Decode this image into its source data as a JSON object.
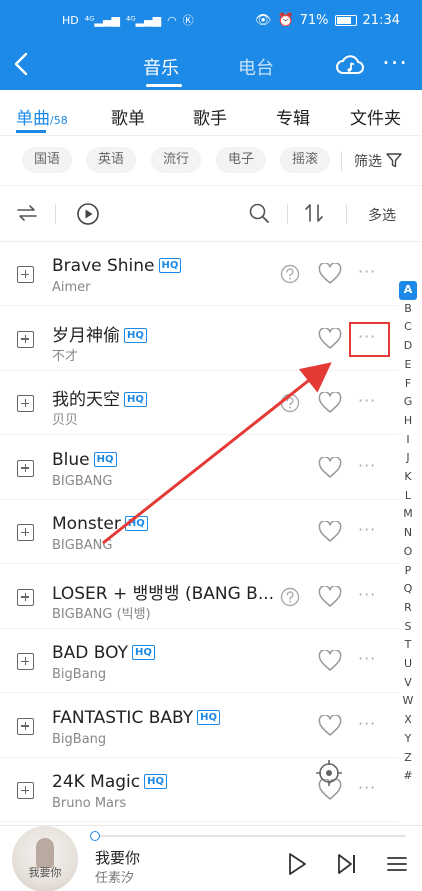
{
  "statusbar": {
    "battery": "71%",
    "time": "21:34"
  },
  "nav": {
    "tab_music": "音乐",
    "tab_radio": "电台"
  },
  "tabs": {
    "songs": "单曲",
    "songs_count": "/58",
    "playlists": "歌单",
    "singers": "歌手",
    "albums": "专辑",
    "folders": "文件夹"
  },
  "filters": {
    "chips": [
      "国语",
      "英语",
      "流行",
      "电子",
      "摇滚"
    ],
    "filter_label": "筛选"
  },
  "toolbar": {
    "multi_select": "多选"
  },
  "hq_label": "HQ",
  "songs": [
    {
      "title": "Brave Shine",
      "artist": "Aimer",
      "hq": true,
      "question": true
    },
    {
      "title": "岁月神偷",
      "artist": "不才",
      "hq": true,
      "question": false
    },
    {
      "title": "我的天空",
      "artist": "贝贝",
      "hq": true,
      "question": true
    },
    {
      "title": "Blue",
      "artist": "BIGBANG",
      "hq": true,
      "question": false
    },
    {
      "title": "Monster",
      "artist": "BIGBANG",
      "hq": true,
      "question": false
    },
    {
      "title": "LOSER + 뱅뱅뱅 (BANG B...",
      "artist": "BIGBANG (빅뱅)",
      "hq": false,
      "question": true
    },
    {
      "title": "BAD BOY",
      "artist": "BigBang",
      "hq": true,
      "question": false
    },
    {
      "title": "FANTASTIC BABY",
      "artist": "BigBang",
      "hq": true,
      "question": false
    },
    {
      "title": "24K Magic",
      "artist": "Bruno Mars",
      "hq": true,
      "question": false
    }
  ],
  "alphabet": [
    "A",
    "B",
    "C",
    "D",
    "E",
    "F",
    "G",
    "H",
    "I",
    "J",
    "K",
    "L",
    "M",
    "N",
    "O",
    "P",
    "Q",
    "R",
    "S",
    "T",
    "U",
    "V",
    "W",
    "X",
    "Y",
    "Z",
    "#"
  ],
  "player": {
    "song": "我要你",
    "singer": "任素汐",
    "cover_text": "我要你",
    "progress": 0.0
  },
  "colors": {
    "accent": "#1e8ae8",
    "highlight": "#e53935"
  }
}
